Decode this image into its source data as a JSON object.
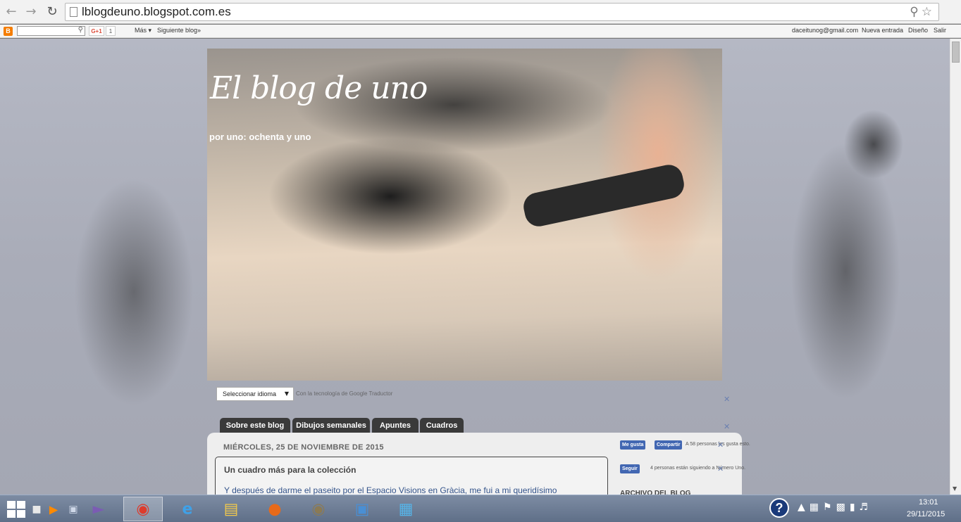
{
  "browser": {
    "url": "lblogdeuno.blogspot.com.es"
  },
  "navbar": {
    "gplus_label": "G+1",
    "gplus_count": "1",
    "more_label": "Más ▾",
    "next_blog_label": "Siguiente blog»",
    "user_email": "daceitunog@gmail.com",
    "new_post_label": "Nueva entrada",
    "design_label": "Diseño",
    "exit_label": "Salir"
  },
  "blog": {
    "title": "El blog de uno",
    "description": "por uno: ochenta y uno"
  },
  "translate": {
    "select_label": "Seleccionar idioma",
    "powered_label": "Con la tecnología de Google Traductor"
  },
  "tabs": [
    "Sobre este blog",
    "Dibujos semanales",
    "Apuntes",
    "Cuadros"
  ],
  "post": {
    "date_header": "MIÉRCOLES, 25 DE NOVIEMBRE DE 2015",
    "title": "Un cuadro más para la colección",
    "snippet": "Y después de darme el paseito por el Espacio Visions en Gràcia, me fui a mi queridísimo"
  },
  "sidebar": {
    "like_label": "Me gusta",
    "share_label": "Compartir",
    "likes_text": "A 58 personas les gusta esto.",
    "follow_label": "Seguir",
    "followers_text": "4 personas están siguiendo a Número Uno.",
    "archive_header": "ARCHIVO DEL BLOG"
  },
  "taskbar": {
    "time": "13:01",
    "date": "29/11/2015"
  }
}
